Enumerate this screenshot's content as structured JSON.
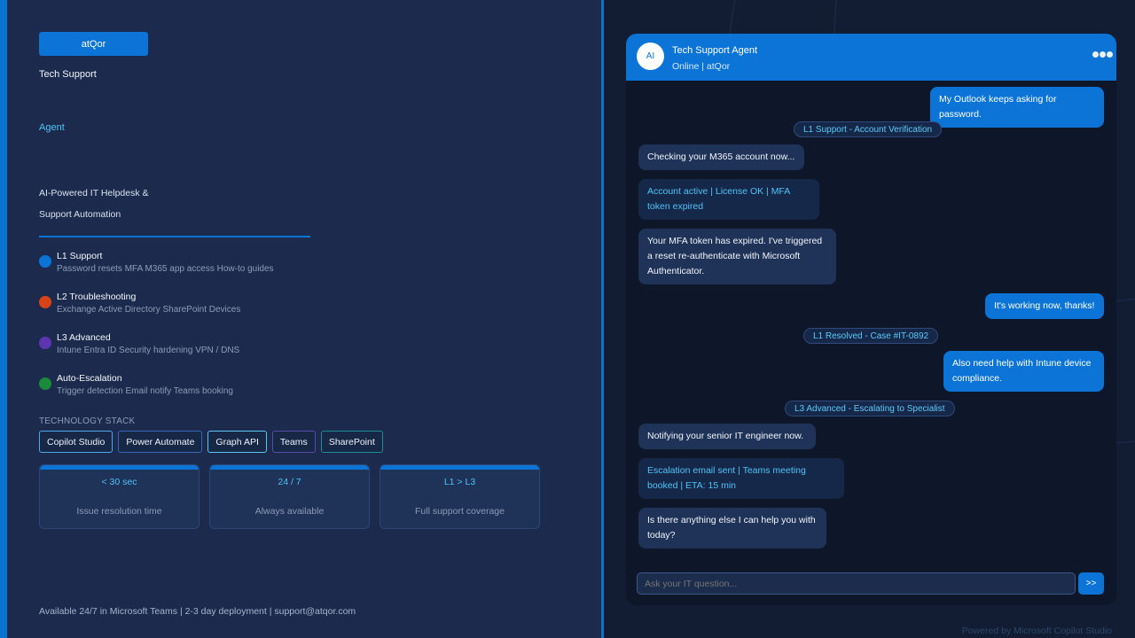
{
  "brand": {
    "button_label": "atQor"
  },
  "hero": {
    "title_line1": "Tech Support",
    "title_line2": "Agent",
    "tagline_line1": "AI-Powered IT Helpdesk &",
    "tagline_line2": "Support Automation"
  },
  "tiers": [
    {
      "title": "L1 Support",
      "subtitle": "Password resets  MFA  M365 app access  How-to guides",
      "color": "#0b74d6"
    },
    {
      "title": "L2 Troubleshooting",
      "subtitle": "Exchange  Active Directory  SharePoint  Devices",
      "color": "#d84315"
    },
    {
      "title": "L3 Advanced",
      "subtitle": "Intune  Entra ID  Security hardening  VPN / DNS",
      "color": "#5e35b1"
    },
    {
      "title": "Auto-Escalation",
      "subtitle": "Trigger detection  Email notify  Teams booking",
      "color": "#1b8a3a"
    }
  ],
  "stack": {
    "label": "TECHNOLOGY STACK",
    "items": [
      "Copilot Studio",
      "Power Automate",
      "Graph API",
      "Teams",
      "SharePoint"
    ]
  },
  "stats": [
    {
      "value": "< 30 sec",
      "label": "Issue resolution time"
    },
    {
      "value": "24 / 7",
      "label": "Always available"
    },
    {
      "value": "L1 > L3",
      "label": "Full support coverage"
    }
  ],
  "footer": {
    "text": "Available 24/7 in Microsoft Teams  |  2-3 day deployment  |  support@atqor.com"
  },
  "chat": {
    "avatar": "AI",
    "agent_name": "Tech Support Agent",
    "status": "Online  |  atQor",
    "messages": [
      "My Outlook keeps asking for password.",
      "L1 Support  -  Account Verification",
      "Checking your M365 account now...",
      "Account active | License OK | MFA token expired",
      "Your MFA token has expired. I've triggered a reset re-authenticate with Microsoft Authenticator.",
      "It's working now, thanks!",
      "L1 Resolved  -  Case #IT-0892",
      "Also need help with Intune device compliance.",
      "L3 Advanced  -  Escalating to Specialist",
      "Notifying your senior IT engineer now.",
      "Escalation email sent | Teams meeting booked | ETA: 15 min",
      "Is there anything else I can help you with today?"
    ],
    "input_placeholder": "Ask your IT question...",
    "send_label": ">>"
  },
  "powered_by": "Powered by Microsoft Copilot Studio",
  "colors": {
    "accent": "#0b74d6",
    "highlight": "#4fc3f7",
    "panel": "#1c2b4d",
    "chat_bg": "#0d1729"
  }
}
